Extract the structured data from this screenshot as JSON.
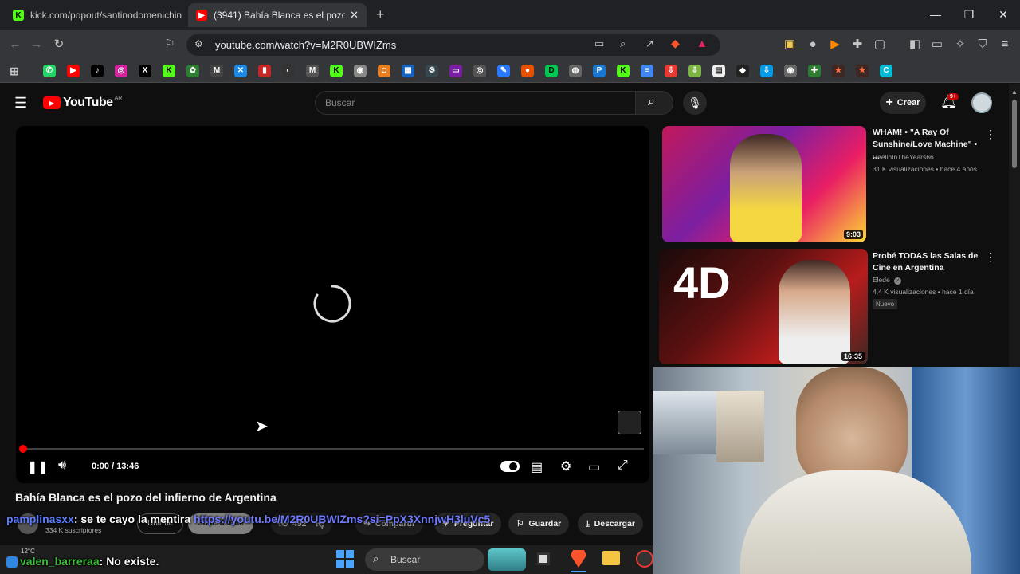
{
  "browser": {
    "tabs": [
      {
        "label": "kick.com/popout/santinodomenichin"
      },
      {
        "label": "(3941) Bahía Blanca es el pozo d"
      }
    ],
    "url": "youtube.com/watch?v=M2R0UBWIZms"
  },
  "youtube": {
    "logo_text": "YouTube",
    "region": "AR",
    "search_placeholder": "Buscar",
    "create_label": "Crear",
    "notif_count": "9+",
    "player": {
      "time": "0:00 / 13:46",
      "progress": 0
    },
    "video_title": "Bahía Blanca es el pozo del infierno de Argentina",
    "channel_subs": "334 K suscriptores",
    "online_label": "Unirme",
    "subscribe_label": "Suscribirme",
    "likes": "492",
    "share_label": "Compartir",
    "ask_label": "Preguntar",
    "save_label": "Guardar",
    "download_label": "Descargar",
    "recommended": [
      {
        "title": "WHAM! • \"A Ray Of Sunshine/Love Machine\" • ...",
        "channel": "ReelinInTheYears66",
        "meta": "31 K visualizaciones • hace 4 años",
        "duration": "9:03"
      },
      {
        "title": "Probé TODAS las Salas de Cine en Argentina",
        "channel": "Elede",
        "meta": "4,4 K visualizaciones • hace 1 día",
        "badge": "Nuevo",
        "duration": "16:35",
        "thumb_text": "4D"
      }
    ]
  },
  "chat": [
    {
      "user": "pamplinasxx",
      "message": ": se te cayo la mentira ",
      "link": "https://youtu.be/M2R0UBWIZms?si=PpX3XnnjwH3luVc5"
    },
    {
      "user": "valen_barreraa",
      "message": ": No existe."
    }
  ],
  "taskbar": {
    "search_placeholder": "Buscar",
    "weather": "12°C"
  },
  "colors": {
    "yt_red": "#ff0000",
    "chat_user1": "#5a7cff",
    "chat_user2": "#3fbf3f",
    "link": "#6f7bff"
  }
}
